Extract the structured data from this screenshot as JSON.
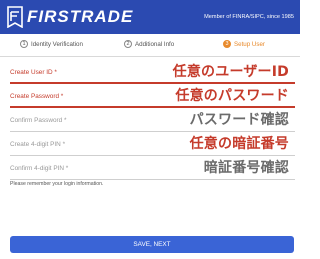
{
  "header": {
    "brand": "FIRSTRADE",
    "member_text": "Member of FINRA/SIPC, since 1985",
    "color": "#2b4ab1"
  },
  "steps": [
    {
      "number": "1",
      "label": "Identity Verification",
      "active": false
    },
    {
      "number": "2",
      "label": "Additional Info",
      "active": false
    },
    {
      "number": "3",
      "label": "Setup User",
      "active": true
    }
  ],
  "fields": [
    {
      "label": "Create User ID *",
      "annotation": "任意のユーザーID"
    },
    {
      "label": "Create Password *",
      "annotation": "任意のパスワード"
    },
    {
      "label": "Confirm Password *",
      "annotation": "パスワード確認"
    },
    {
      "label": "Create 4-digit PIN *",
      "annotation": "任意の暗証番号"
    },
    {
      "label": "Confirm 4-digit PIN *",
      "annotation": "暗証番号確認"
    }
  ],
  "note": "Please remember your login information.",
  "button": {
    "label": "SAVE, NEXT",
    "color": "#3a64d6"
  },
  "accent": "#e88a2c",
  "highlight": "#c53b2b"
}
